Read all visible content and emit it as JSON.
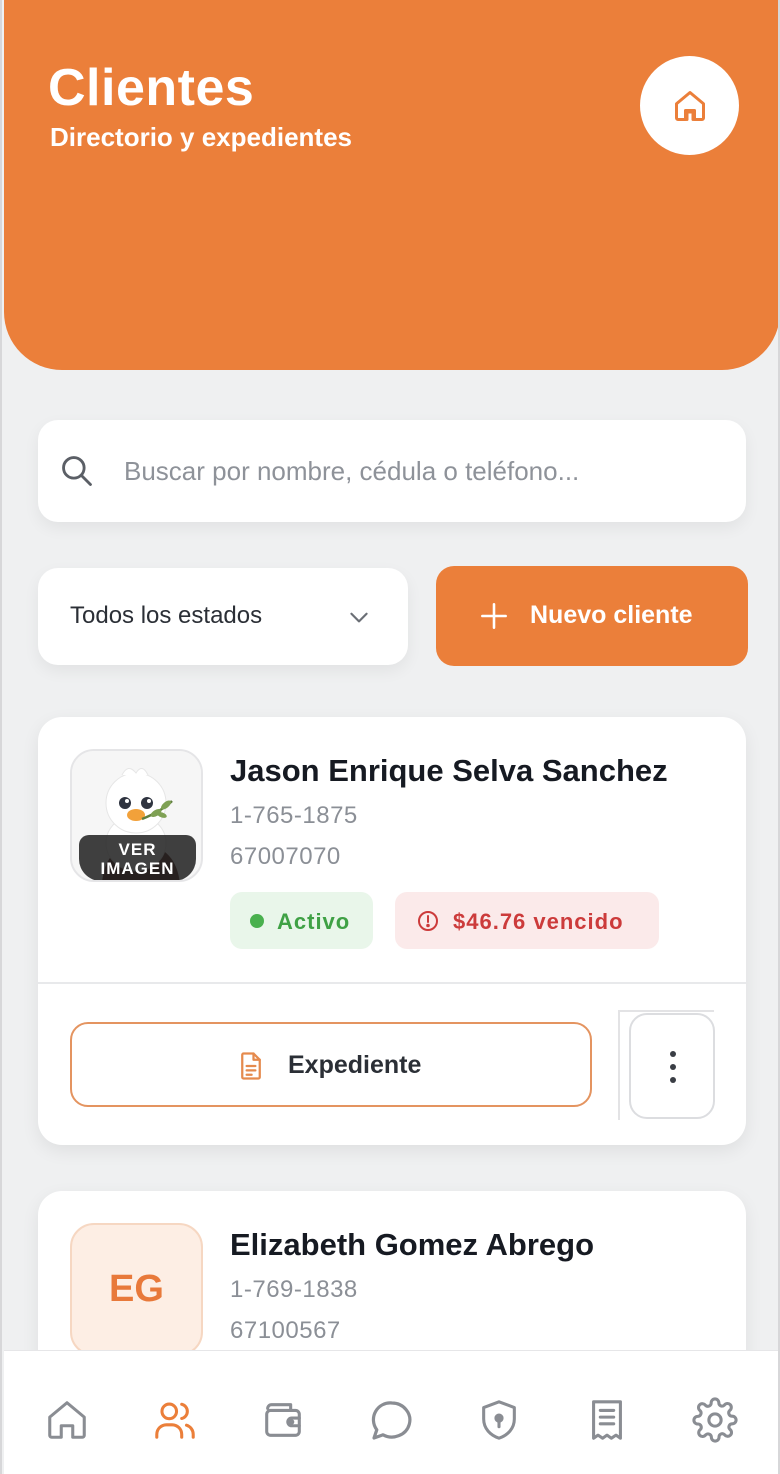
{
  "header": {
    "title": "Clientes",
    "subtitle": "Directorio y expedientes",
    "home_icon": "home-icon"
  },
  "search": {
    "placeholder": "Buscar por nombre, cédula o teléfono...",
    "value": ""
  },
  "filter": {
    "selected": "Todos los estados"
  },
  "new_client_button": {
    "label": "Nuevo cliente"
  },
  "clients": [
    {
      "name": "Jason Enrique Selva Sanchez",
      "id_number": "1-765-1875",
      "phone": "67007070",
      "avatar_overlay": "VER IMAGEN",
      "status": "Activo",
      "due": "$46.76 vencido",
      "record_button": "Expediente"
    },
    {
      "name": "Elizabeth Gomez Abrego",
      "id_number": "1-769-1838",
      "phone": "67100567",
      "initials": "EG"
    }
  ],
  "bottom_nav": [
    {
      "name": "home",
      "icon": "home-icon"
    },
    {
      "name": "clients",
      "icon": "users-icon",
      "active": true
    },
    {
      "name": "wallet",
      "icon": "wallet-icon"
    },
    {
      "name": "chat",
      "icon": "chat-icon"
    },
    {
      "name": "security",
      "icon": "shield-icon"
    },
    {
      "name": "receipts",
      "icon": "receipt-icon"
    },
    {
      "name": "settings",
      "icon": "gear-icon"
    }
  ],
  "colors": {
    "accent": "#eb7f3a",
    "active_green": "#3fa145",
    "due_red": "#cc3b3b",
    "nav_inactive": "#8a8d93"
  }
}
